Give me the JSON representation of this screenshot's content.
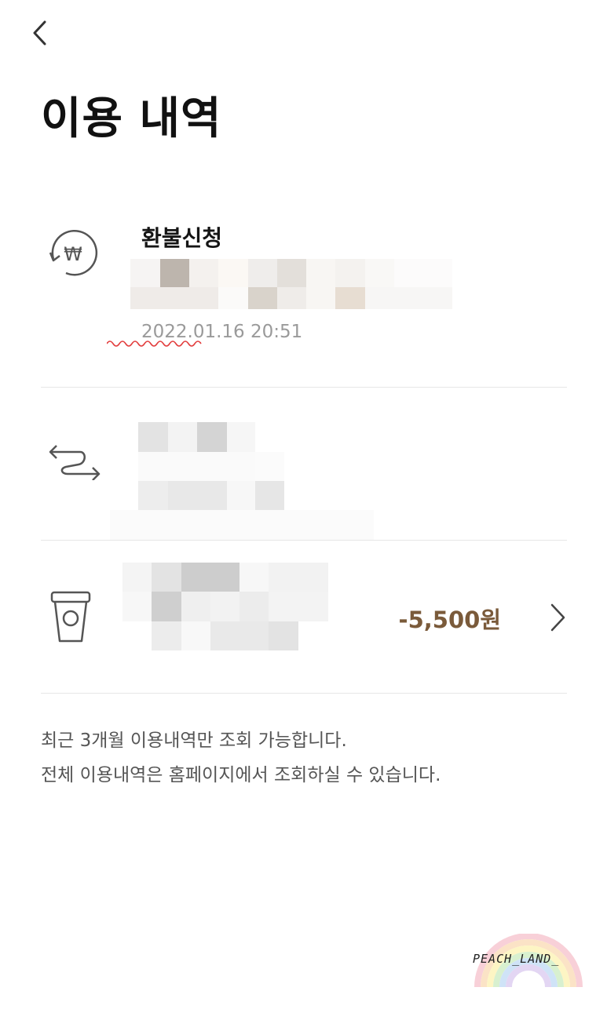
{
  "header": {
    "title": "이용 내역"
  },
  "history": [
    {
      "icon": "won-refund-icon",
      "title": "환불신청",
      "datetime": "2022.01.16 20:51"
    },
    {
      "icon": "transfer-arrows-icon"
    },
    {
      "icon": "coffee-cup-icon",
      "amount": "-5,500원"
    }
  ],
  "notice": {
    "line1": "최근 3개월 이용내역만 조회 가능합니다.",
    "line2": "전체 이용내역은 홈페이지에서 조회하실 수 있습니다."
  },
  "watermark": {
    "text": "PEACH_LAND_"
  },
  "colors": {
    "amount": "#7a5a3a",
    "divider": "#e6e6e6",
    "date": "#9a9a9a"
  }
}
